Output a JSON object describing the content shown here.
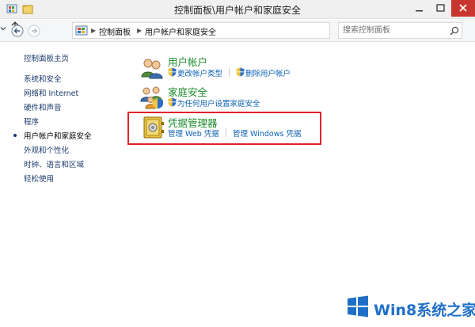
{
  "window": {
    "title": "控制面板\\用户帐户和家庭安全"
  },
  "address": {
    "crumbs": [
      "控制面板",
      "用户帐户和家庭安全"
    ]
  },
  "search": {
    "placeholder": "搜索控制面板"
  },
  "sidebar": {
    "items": [
      {
        "label": "控制面板主页",
        "current": false
      },
      {
        "label": "系统和安全",
        "current": false
      },
      {
        "label": "网络和 Internet",
        "current": false
      },
      {
        "label": "硬件和声音",
        "current": false
      },
      {
        "label": "程序",
        "current": false
      },
      {
        "label": "用户帐户和家庭安全",
        "current": true
      },
      {
        "label": "外观和个性化",
        "current": false
      },
      {
        "label": "时钟、语言和区域",
        "current": false
      },
      {
        "label": "轻松使用",
        "current": false
      }
    ]
  },
  "categories": [
    {
      "title": "用户帐户",
      "icon": "user-accounts-icon",
      "links": [
        "更改帐户类型",
        "删除用户帐户"
      ]
    },
    {
      "title": "家庭安全",
      "icon": "family-safety-icon",
      "links": [
        "为任何用户设置家庭安全"
      ]
    },
    {
      "title": "凭据管理器",
      "icon": "credential-manager-icon",
      "links": [
        "管理 Web 凭据",
        "管理 Windows 凭据"
      ]
    }
  ],
  "highlight": {
    "color": "#e2202a",
    "target": "凭据管理器"
  },
  "watermark": {
    "text": "Win8系统之家",
    "color": "#1f6fc8"
  },
  "colors": {
    "category_title": "#1c8c2c",
    "link": "#0f62b4",
    "nav_link": "#1b3a6b"
  }
}
